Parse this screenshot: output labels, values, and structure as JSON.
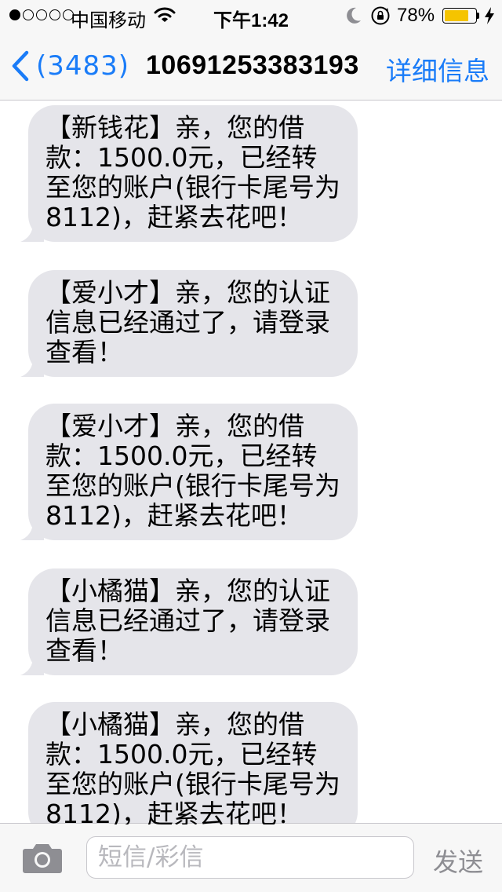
{
  "status_bar": {
    "carrier": "中国移动",
    "time": "下午1:42",
    "battery_percent": "78%",
    "battery_level": 0.78,
    "signal_bars_filled": 1,
    "signal_bars_total": 5,
    "battery_color": "#f5c400"
  },
  "nav": {
    "back_label": "(3483)",
    "title": "10691253383193",
    "details_label": "详细信息",
    "accent_color": "#1a7cf8"
  },
  "messages": [
    {
      "text": "【新钱花】亲，您的借款：1500.0元，已经转至您的账户(银行卡尾号为8112)，赶紧去花吧！"
    },
    {
      "text": "【爱小才】亲，您的认证信息已经通过了，请登录查看！"
    },
    {
      "text": "【爱小才】亲，您的借款：1500.0元，已经转至您的账户(银行卡尾号为8112)，赶紧去花吧！"
    },
    {
      "text": "【小橘猫】亲，您的认证信息已经通过了，请登录查看！"
    },
    {
      "text": "【小橘猫】亲，您的借款：1500.0元，已经转至您的账户(银行卡尾号为8112)，赶紧去花吧！"
    }
  ],
  "composer": {
    "placeholder": "短信/彩信",
    "send_label": "发送",
    "camera_icon": "camera-icon"
  },
  "bubble_color": "#e5e5ea"
}
